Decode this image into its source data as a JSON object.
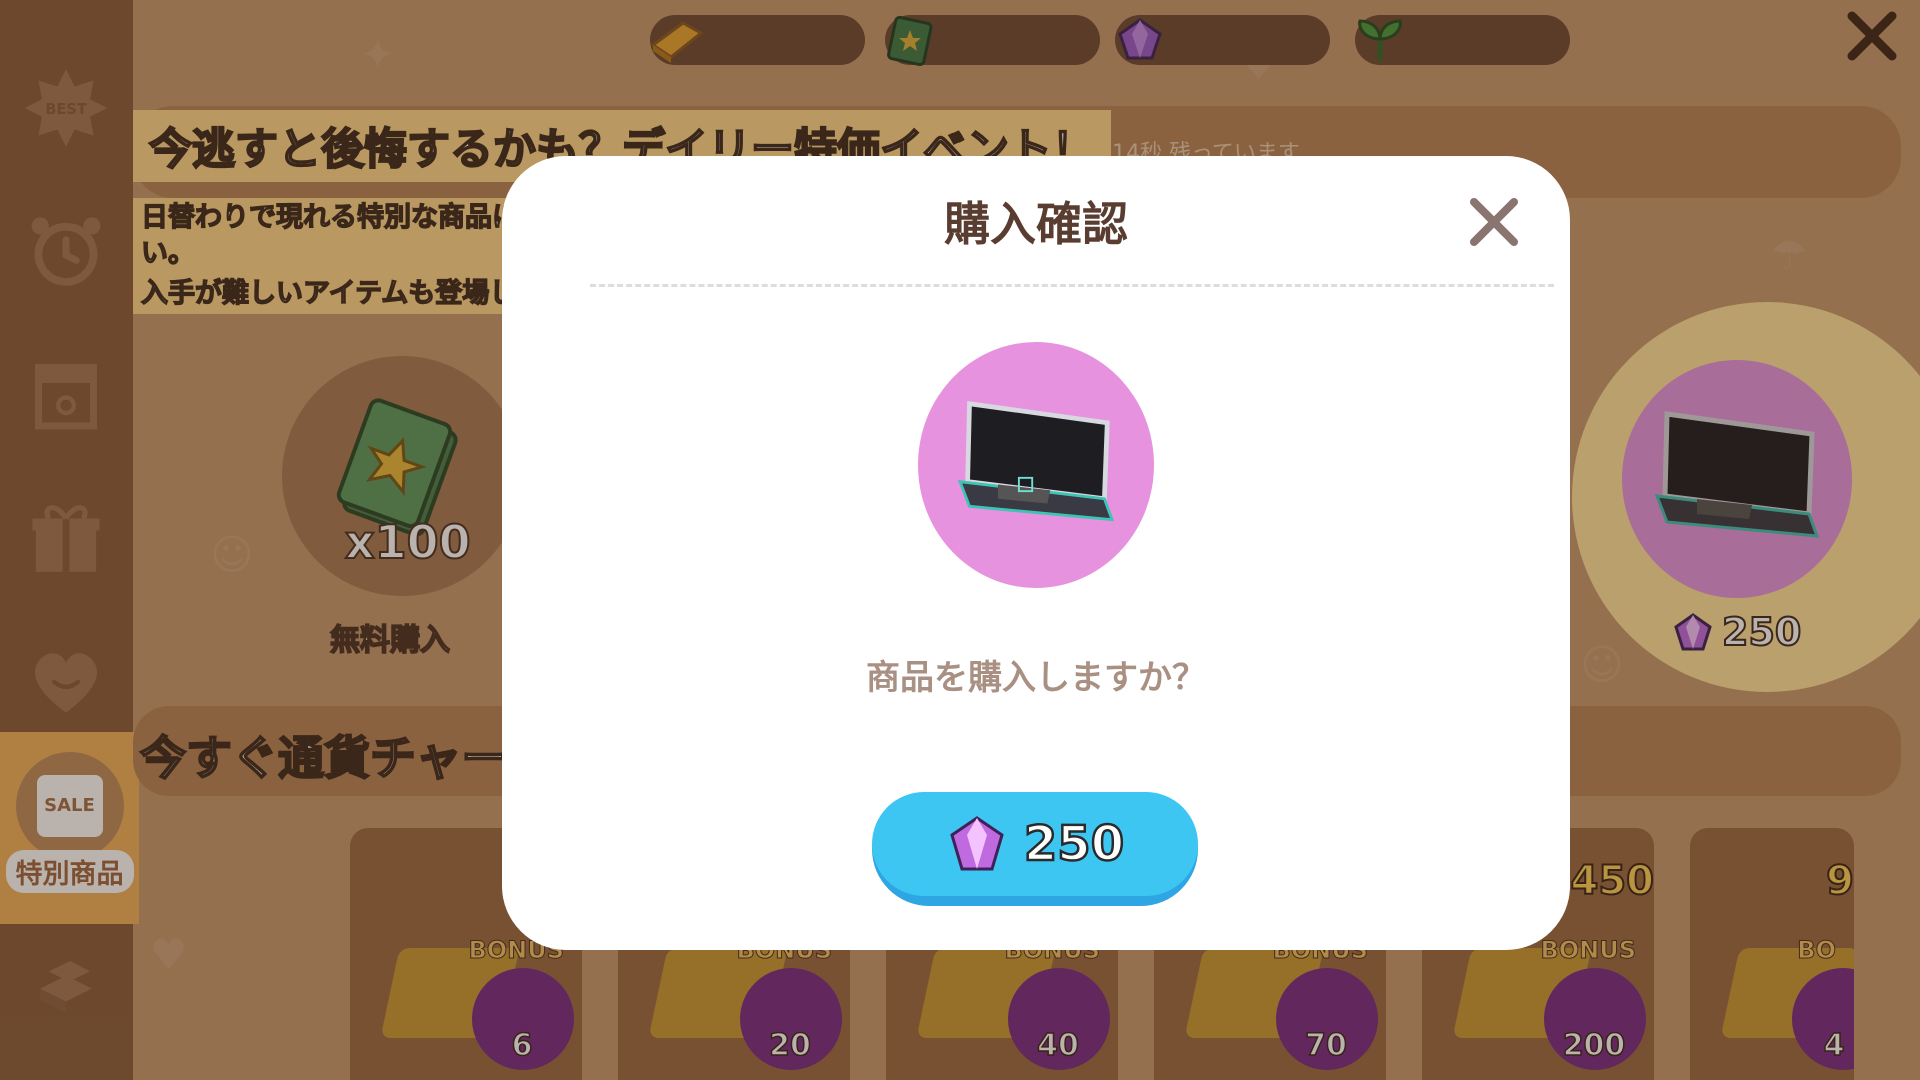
{
  "sidebar": {
    "items": [
      {
        "name": "best",
        "label": "BEST"
      },
      {
        "name": "alarm",
        "label": ""
      },
      {
        "name": "shop-stand",
        "label": ""
      },
      {
        "name": "gift",
        "label": ""
      },
      {
        "name": "heart",
        "label": ""
      },
      {
        "name": "special",
        "label": "特別商品",
        "badge": "SALE"
      },
      {
        "name": "gold-bars",
        "label": ""
      }
    ]
  },
  "topbar": {
    "currencies": [
      "gold-bar-icon",
      "ticket-icon",
      "gem-icon",
      "sprout-icon"
    ]
  },
  "banner": {
    "headline": "今逃すと後悔するかも？デイリー特価イベント！",
    "subline_1": "日替わりで現れる特別な商品にご期待ください。",
    "subline_2": "入手が難しいアイテムも登場します！",
    "timer": "8時間 44分 14秒 残っています"
  },
  "free_item": {
    "quantity": "x100",
    "label": "無料購入"
  },
  "featured_item": {
    "price": "250"
  },
  "charge_section": {
    "title": "今すぐ通貨チャージ",
    "cards": [
      {
        "bonus_label": "BONUS",
        "bonus": "6",
        "top": ""
      },
      {
        "bonus_label": "BONUS",
        "bonus": "20",
        "top": ""
      },
      {
        "bonus_label": "BONUS",
        "bonus": "40",
        "top": ""
      },
      {
        "bonus_label": "BONUS",
        "bonus": "70",
        "top": ""
      },
      {
        "bonus_label": "BONUS",
        "bonus": "200",
        "top": "450"
      },
      {
        "bonus_label": "BO",
        "bonus": "4",
        "top": "9"
      }
    ]
  },
  "modal": {
    "title": "購入確認",
    "question": "商品を購入しますか？",
    "price": "250"
  },
  "colors": {
    "modal_bg": "#ffffff",
    "button": "#3ec6f2",
    "product_circle": "#e692df",
    "highlight": "#ffd98a"
  }
}
